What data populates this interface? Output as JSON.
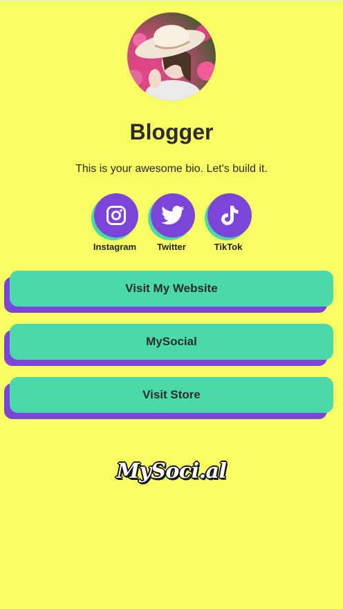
{
  "profile": {
    "name": "Blogger",
    "bio": "This is your awesome bio. Let's build it."
  },
  "socials": [
    {
      "label": "Instagram",
      "icon": "instagram-icon"
    },
    {
      "label": "Twitter",
      "icon": "twitter-icon"
    },
    {
      "label": "TikTok",
      "icon": "tiktok-icon"
    }
  ],
  "links": [
    {
      "label": "Visit My Website"
    },
    {
      "label": "MySocial"
    },
    {
      "label": "Visit Store"
    }
  ],
  "footer": {
    "brand": "MySoci.al"
  },
  "colors": {
    "background": "#f9fd62",
    "accent_purple": "#7a45d8",
    "accent_green": "#49d9ab",
    "text": "#2b2b2b"
  }
}
